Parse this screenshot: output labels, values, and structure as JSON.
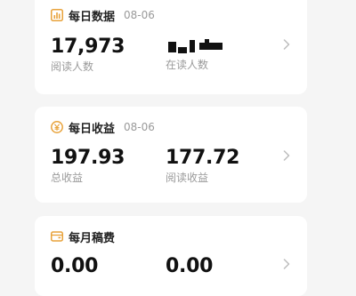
{
  "cards": [
    {
      "title": "每日数据",
      "date": "08-06",
      "stats": [
        {
          "value": "17,973",
          "label": "阅读人数"
        },
        {
          "value": "",
          "label": "在读人数"
        }
      ]
    },
    {
      "title": "每日收益",
      "date": "08-06",
      "stats": [
        {
          "value": "197.93",
          "label": "总收益"
        },
        {
          "value": "177.72",
          "label": "阅读收益"
        }
      ]
    },
    {
      "title": "每月稿费",
      "stats": [
        {
          "value": "0.00"
        },
        {
          "value": "0.00"
        }
      ]
    }
  ],
  "colors": {
    "accent": "#e8a23a",
    "muted": "#9a9a9a",
    "card": "#ffffff",
    "background": "#f5f5f5"
  },
  "icons": [
    "bar-chart-icon",
    "coin-icon",
    "wallet-icon",
    "chevron-right-icon"
  ]
}
